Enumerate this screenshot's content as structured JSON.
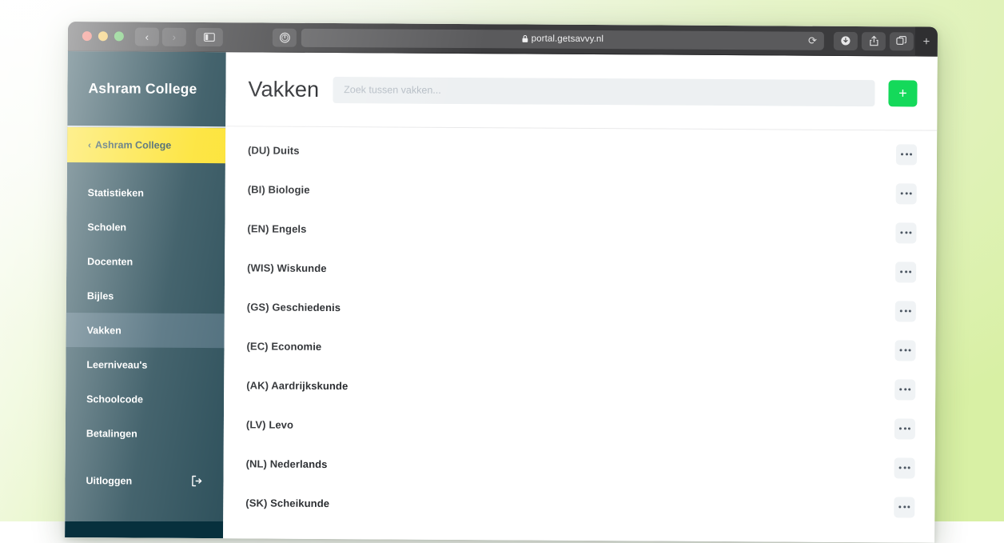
{
  "browser": {
    "traffic_lights": [
      "close",
      "minimize",
      "zoom"
    ],
    "back_label": "‹",
    "forward_label": "›",
    "sidebar_toggle_icon": "sidebar-icon",
    "password_manager_icon": "password-manager-icon",
    "url": "portal.getsavvy.nl",
    "lock_icon": "🔒",
    "reload_icon": "⟳",
    "download_icon": "download-icon",
    "share_icon": "share-icon",
    "tabs_icon": "tab-overview-icon",
    "new_tab_label": "+"
  },
  "sidebar": {
    "brand": "Ashram College",
    "back_item": {
      "chevron": "‹",
      "label": "Ashram College"
    },
    "items": [
      {
        "label": "Statistieken",
        "active": false
      },
      {
        "label": "Scholen",
        "active": false
      },
      {
        "label": "Docenten",
        "active": false
      },
      {
        "label": "Bijles",
        "active": false
      },
      {
        "label": "Vakken",
        "active": true
      },
      {
        "label": "Leerniveau's",
        "active": false
      },
      {
        "label": "Schoolcode",
        "active": false
      },
      {
        "label": "Betalingen",
        "active": false
      }
    ],
    "logout": {
      "label": "Uitloggen",
      "icon": "logout-icon"
    }
  },
  "header": {
    "title": "Vakken",
    "search_placeholder": "Zoek tussen vakken...",
    "search_value": "",
    "add_label": "+"
  },
  "subjects": [
    {
      "label": "(DU) Duits",
      "menu": "•••"
    },
    {
      "label": "(BI) Biologie",
      "menu": "•••"
    },
    {
      "label": "(EN) Engels",
      "menu": "•••"
    },
    {
      "label": "(WIS) Wiskunde",
      "menu": "•••"
    },
    {
      "label": "(GS) Geschiedenis",
      "menu": "•••"
    },
    {
      "label": "(EC) Economie",
      "menu": "•••"
    },
    {
      "label": "(AK) Aardrijkskunde",
      "menu": "•••"
    },
    {
      "label": "(LV) Levo",
      "menu": "•••"
    },
    {
      "label": "(NL) Nederlands",
      "menu": "•••"
    },
    {
      "label": "(SK) Scheikunde",
      "menu": "•••"
    }
  ],
  "colors": {
    "sidebar_bg": "#07303d",
    "sidebar_active": "#2d5263",
    "accent_yellow": "#fcdd09",
    "accent_green": "#14d95a",
    "desktop_green": "#d8f0a4",
    "titlebar": "#3b3b3d"
  }
}
